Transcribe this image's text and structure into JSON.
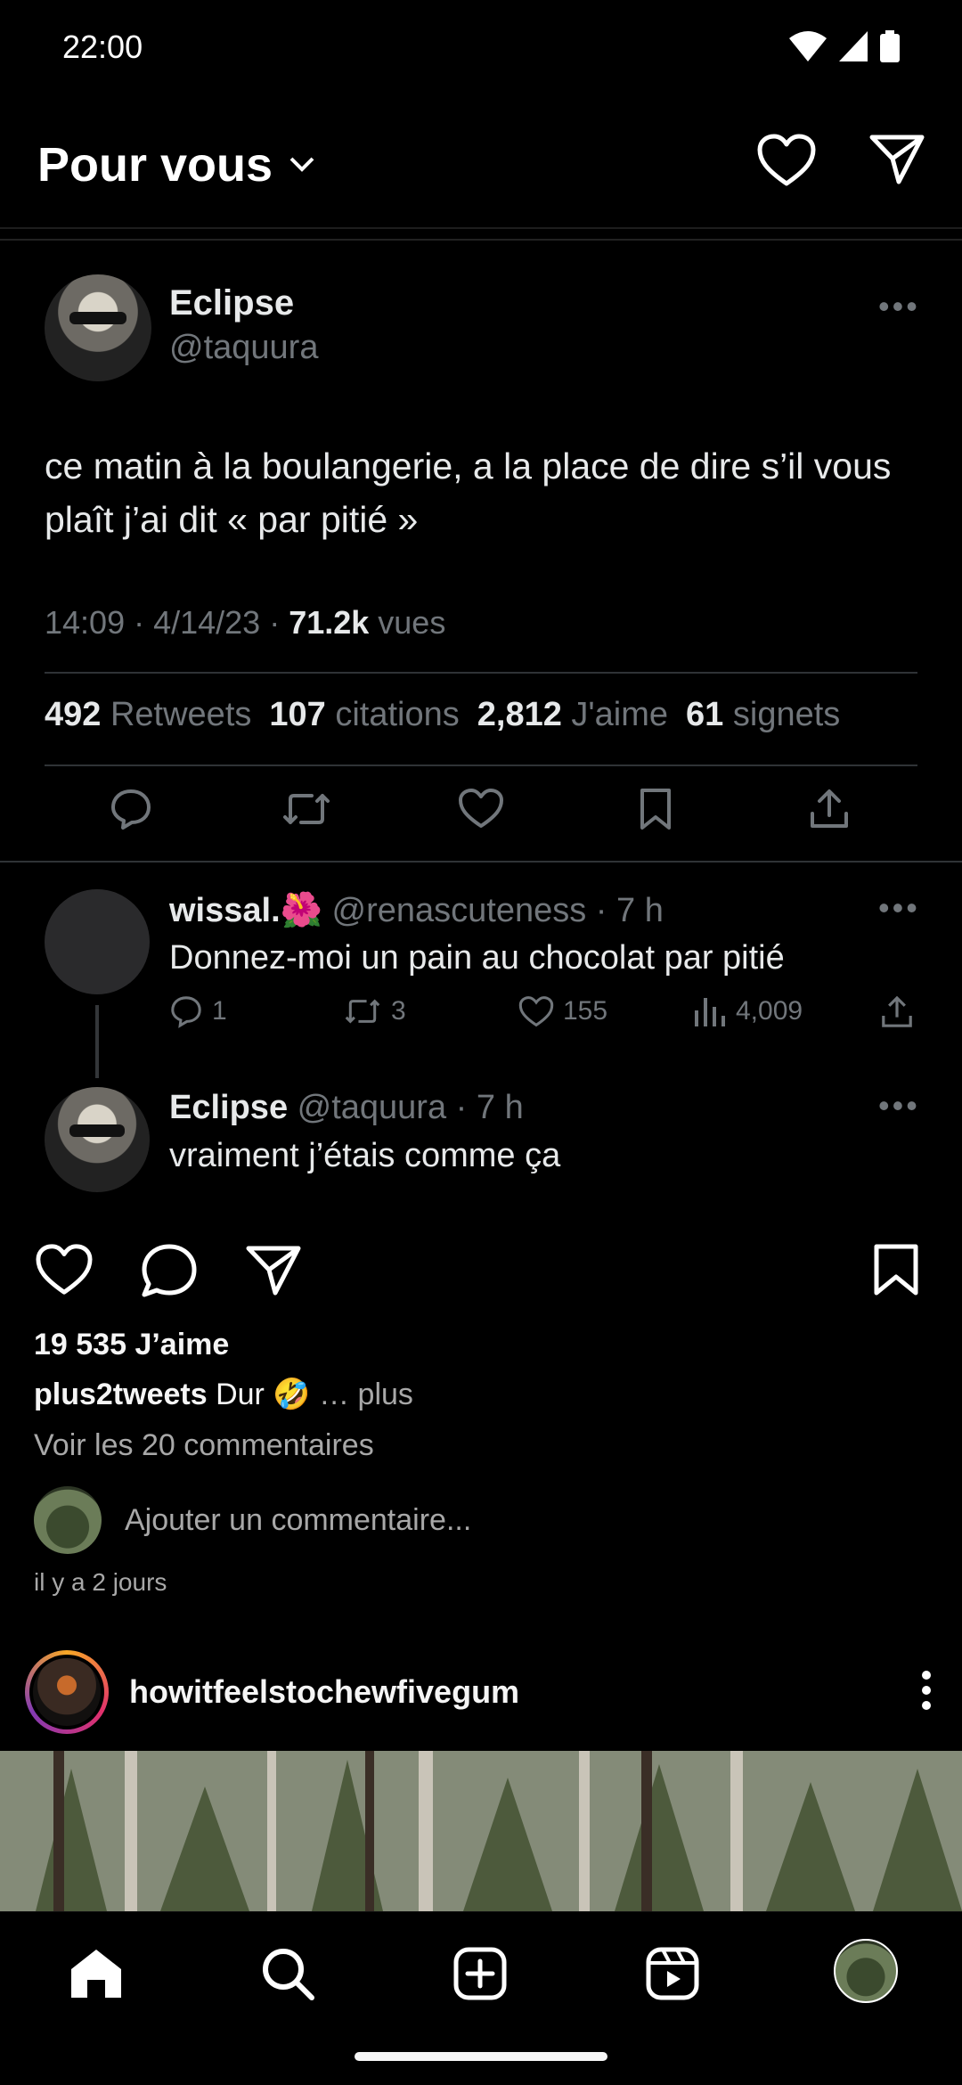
{
  "status_bar": {
    "time": "22:00"
  },
  "header": {
    "title": "Pour vous"
  },
  "tweet": {
    "author_name": "Eclipse",
    "author_handle": "@taquura",
    "text": "ce matin à la boulangerie, a la place de dire s’il vous plaît j’ai dit « par pitié »",
    "time": "14:09 · 4/14/23 · ",
    "views_count": "71.2k",
    "views_label": " vues",
    "stats": {
      "retweets_count": "492",
      "retweets_label": "Retweets",
      "quotes_count": "107",
      "quotes_label": "citations",
      "likes_count": "2,812",
      "likes_label": "J'aime",
      "bookmarks_count": "61",
      "bookmarks_label": "signets"
    }
  },
  "replies": [
    {
      "name": "wissal.🌺",
      "handle": "@renascuteness",
      "time": " · 7 h",
      "text": "Donnez-moi un pain au chocolat par pitié",
      "reply_count": "1",
      "retweet_count": "3",
      "like_count": "155",
      "view_count": "4,009"
    },
    {
      "name": "Eclipse",
      "handle": "@taquura",
      "time": " · 7 h",
      "text": "vraiment j’étais comme ça"
    }
  ],
  "post": {
    "likes": "19 535 J’aime",
    "caption_user": "plus2tweets",
    "caption_text": " Dur 🤣",
    "caption_more": "… plus",
    "view_comments": "Voir les 20 commentaires",
    "add_comment_placeholder": "Ajouter un commentaire...",
    "time_ago": "il y a 2 jours"
  },
  "next_post": {
    "username": "howitfeelstochewfivegum"
  },
  "colors": {
    "muted": "#71767b",
    "text": "#e7e9ea",
    "background": "#000000"
  }
}
